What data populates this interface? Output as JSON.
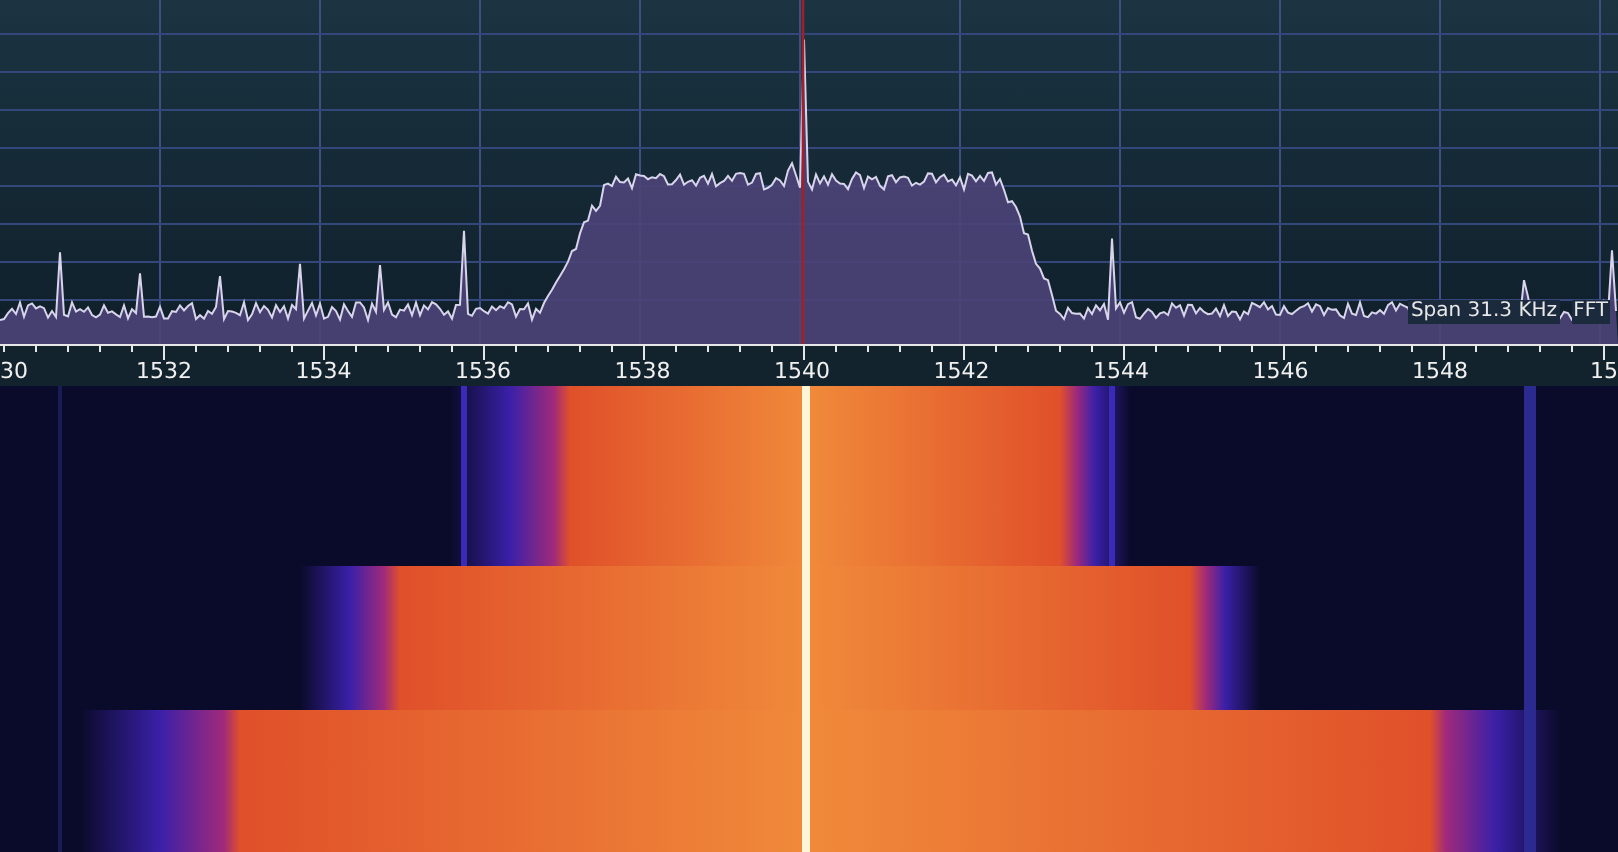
{
  "spectrum": {
    "span_label": "Span 31.3 KHz",
    "mode_label": "FFT"
  },
  "frequency_axis": {
    "labels": [
      "30",
      "1532",
      "1534",
      "1536",
      "1538",
      "1540",
      "1542",
      "1544",
      "1546",
      "1548",
      "15"
    ]
  }
}
